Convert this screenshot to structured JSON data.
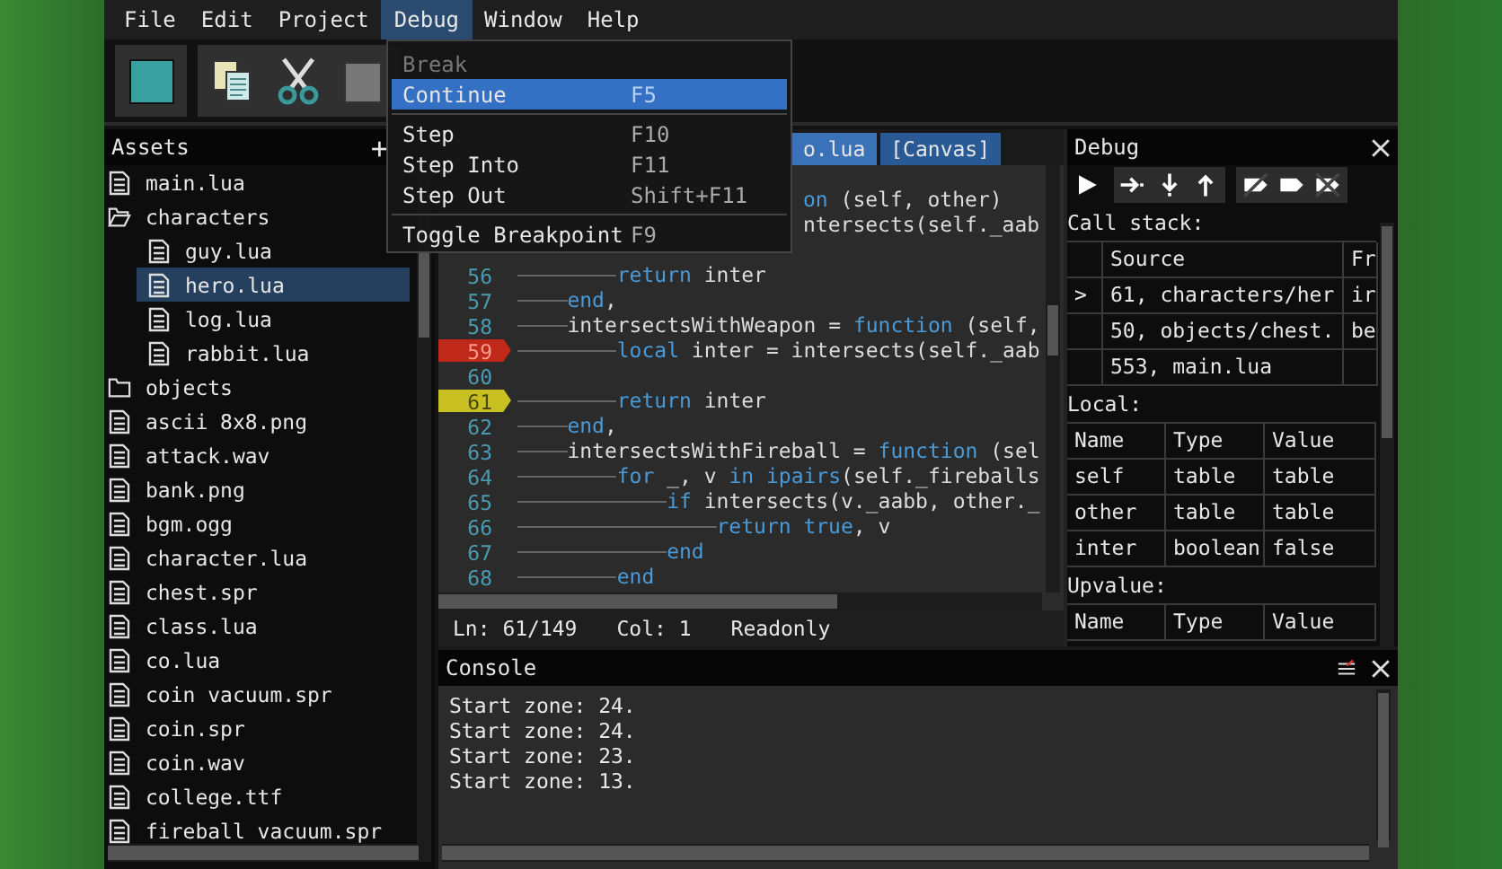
{
  "menu_bar": [
    {
      "label": "File",
      "selected": false
    },
    {
      "label": "Edit",
      "selected": false
    },
    {
      "label": "Project",
      "selected": false
    },
    {
      "label": "Debug",
      "selected": true
    },
    {
      "label": "Window",
      "selected": false
    },
    {
      "label": "Help",
      "selected": false
    }
  ],
  "debug_menu": [
    {
      "kind": "item",
      "label": "Break",
      "disabled": true,
      "selected": false
    },
    {
      "kind": "item",
      "label": "Continue",
      "shortcut": "F5",
      "disabled": false,
      "selected": true
    },
    {
      "kind": "separator"
    },
    {
      "kind": "item",
      "label": "Step",
      "shortcut": "F10",
      "disabled": false,
      "selected": false
    },
    {
      "kind": "item",
      "label": "Step Into",
      "shortcut": "F11",
      "disabled": false,
      "selected": false
    },
    {
      "kind": "item",
      "label": "Step Out",
      "shortcut": "Shift+F11",
      "disabled": false,
      "selected": false
    },
    {
      "kind": "separator"
    },
    {
      "kind": "item",
      "label": "Toggle Breakpoint",
      "shortcut": "F9",
      "disabled": false,
      "selected": false
    }
  ],
  "assets": {
    "title": "Assets",
    "add_button": "+",
    "tree": [
      {
        "kind": "file",
        "name": "main.lua",
        "selected": false
      },
      {
        "kind": "folder",
        "name": "characters",
        "expanded": true,
        "selected": false,
        "children": [
          {
            "kind": "file",
            "name": "guy.lua",
            "selected": false
          },
          {
            "kind": "file",
            "name": "hero.lua",
            "selected": true
          },
          {
            "kind": "file",
            "name": "log.lua",
            "selected": false
          },
          {
            "kind": "file",
            "name": "rabbit.lua",
            "selected": false
          }
        ]
      },
      {
        "kind": "folder",
        "name": "objects",
        "expanded": false,
        "selected": false
      },
      {
        "kind": "file",
        "name": "ascii 8x8.png",
        "selected": false
      },
      {
        "kind": "file",
        "name": "attack.wav",
        "selected": false
      },
      {
        "kind": "file",
        "name": "bank.png",
        "selected": false
      },
      {
        "kind": "file",
        "name": "bgm.ogg",
        "selected": false
      },
      {
        "kind": "file",
        "name": "character.lua",
        "selected": false
      },
      {
        "kind": "file",
        "name": "chest.spr",
        "selected": false
      },
      {
        "kind": "file",
        "name": "class.lua",
        "selected": false
      },
      {
        "kind": "file",
        "name": "co.lua",
        "selected": false
      },
      {
        "kind": "file",
        "name": "coin vacuum.spr",
        "selected": false
      },
      {
        "kind": "file",
        "name": "coin.spr",
        "selected": false
      },
      {
        "kind": "file",
        "name": "coin.wav",
        "selected": false
      },
      {
        "kind": "file",
        "name": "college.ttf",
        "selected": false
      },
      {
        "kind": "file",
        "name": "fireball vacuum.spr",
        "selected": false
      }
    ]
  },
  "editor": {
    "tabs": [
      {
        "label": "o.lua",
        "selected": true
      },
      {
        "label": "[Canvas]",
        "selected": false
      }
    ],
    "lines": [
      {
        "kind": "clipped",
        "segments": [
          {
            "text": "on",
            "keyword": true
          },
          {
            "text": " (self, other)",
            "keyword": false
          }
        ]
      },
      {
        "kind": "clipped",
        "segments": [
          {
            "text": "ntersects(self._aab",
            "keyword": false
          }
        ]
      },
      {
        "kind": "code",
        "num": "56",
        "breakpoint": false,
        "current": false,
        "segments": [
          {
            "text": "\t\treturn",
            "keyword": true
          },
          {
            "text": " inter",
            "keyword": false
          }
        ]
      },
      {
        "kind": "code",
        "num": "57",
        "breakpoint": false,
        "current": false,
        "segments": [
          {
            "text": "\tend",
            "keyword": true
          },
          {
            "text": ",",
            "keyword": false
          }
        ]
      },
      {
        "kind": "code",
        "num": "58",
        "breakpoint": false,
        "current": false,
        "segments": [
          {
            "text": "\tintersectsWithWeapon = ",
            "keyword": false
          },
          {
            "text": "function",
            "keyword": true
          },
          {
            "text": " (self,",
            "keyword": false
          }
        ]
      },
      {
        "kind": "code",
        "num": "59",
        "breakpoint": true,
        "current": false,
        "segments": [
          {
            "text": "\t\tlocal",
            "keyword": true
          },
          {
            "text": " inter = intersects(self._aab",
            "keyword": false
          }
        ]
      },
      {
        "kind": "code",
        "num": "60",
        "breakpoint": false,
        "current": false
      },
      {
        "kind": "code",
        "num": "61",
        "breakpoint": false,
        "current": true,
        "segments": [
          {
            "text": "\t\treturn",
            "keyword": true
          },
          {
            "text": " inter",
            "keyword": false
          }
        ]
      },
      {
        "kind": "code",
        "num": "62",
        "breakpoint": false,
        "current": false,
        "segments": [
          {
            "text": "\tend",
            "keyword": true
          },
          {
            "text": ",",
            "keyword": false
          }
        ]
      },
      {
        "kind": "code",
        "num": "63",
        "breakpoint": false,
        "current": false,
        "segments": [
          {
            "text": "\tintersectsWithFireball = ",
            "keyword": false
          },
          {
            "text": "function",
            "keyword": true
          },
          {
            "text": " (sel",
            "keyword": false
          }
        ]
      },
      {
        "kind": "code",
        "num": "64",
        "breakpoint": false,
        "current": false,
        "segments": [
          {
            "text": "\t\tfor",
            "keyword": true
          },
          {
            "text": " _, v ",
            "keyword": false
          },
          {
            "text": "in ipairs",
            "keyword": true
          },
          {
            "text": "(self._fireballs",
            "keyword": false
          }
        ]
      },
      {
        "kind": "code",
        "num": "65",
        "breakpoint": false,
        "current": false,
        "segments": [
          {
            "text": "\t\t\tif",
            "keyword": true
          },
          {
            "text": " intersects(v._aabb, other._",
            "keyword": false
          }
        ]
      },
      {
        "kind": "code",
        "num": "66",
        "breakpoint": false,
        "current": false,
        "segments": [
          {
            "text": "\t\t\t\treturn true",
            "keyword": true
          },
          {
            "text": ", v",
            "keyword": false
          }
        ]
      },
      {
        "kind": "code",
        "num": "67",
        "breakpoint": false,
        "current": false,
        "segments": [
          {
            "text": "\t\t\tend",
            "keyword": true
          }
        ]
      },
      {
        "kind": "code",
        "num": "68",
        "breakpoint": false,
        "current": false,
        "segments": [
          {
            "text": "\t\tend",
            "keyword": true
          }
        ]
      }
    ],
    "status": [
      "Ln: 61/149",
      "Col: 1",
      "Readonly"
    ]
  },
  "debug_panel": {
    "title": "Debug",
    "call_stack": {
      "label": "Call stack:",
      "columns": [
        "",
        "Source",
        "Fr"
      ],
      "rows": [
        [
          ">",
          "61, characters/her",
          "ir"
        ],
        [
          "",
          "50, objects/chest.",
          "be"
        ],
        [
          "",
          "553, main.lua",
          ""
        ]
      ]
    },
    "locals": {
      "label": "Local:",
      "columns": [
        "Name",
        "Type",
        "Value"
      ],
      "rows": [
        [
          "self",
          "table",
          "table"
        ],
        [
          "other",
          "table",
          "table"
        ],
        [
          "inter",
          "boolean",
          "false"
        ]
      ]
    },
    "upvalues": {
      "label": "Upvalue:",
      "columns": [
        "Name",
        "Type",
        "Value"
      ]
    }
  },
  "console": {
    "title": "Console",
    "lines": [
      "Start zone: 24.",
      "Start zone: 24.",
      "Start zone: 23.",
      "Start zone: 13."
    ]
  }
}
